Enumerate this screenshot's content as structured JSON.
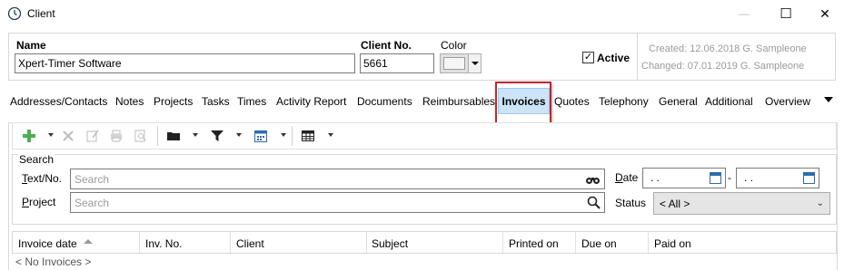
{
  "window": {
    "title": "Client",
    "minimize_glyph": "—",
    "maximize_glyph": "☐",
    "close_glyph": "✕"
  },
  "header": {
    "name_label": "Name",
    "name_value": "Xpert-Timer Software",
    "client_no_label": "Client No.",
    "client_no_value": "5661",
    "color_label": "Color",
    "active_label": "Active",
    "active_checked": true,
    "check_glyph": "✓",
    "created": "Created: 12.06.2018 G. Sampleone",
    "changed": "Changed: 07.01.2019 G. Sampleone"
  },
  "tabs": [
    {
      "label": "Addresses/Contacts"
    },
    {
      "label": "Notes"
    },
    {
      "label": "Projects"
    },
    {
      "label": "Tasks"
    },
    {
      "label": "Times"
    },
    {
      "label": "Activity Report"
    },
    {
      "label": "Documents"
    },
    {
      "label": "Reimbursables"
    },
    {
      "label": "Invoices",
      "active": true
    },
    {
      "label": "Quotes"
    },
    {
      "label": "Telephony"
    },
    {
      "label": "General"
    },
    {
      "label": "Additional"
    },
    {
      "label": "Overview"
    }
  ],
  "toolbar": {
    "icons": [
      "add-icon",
      "delete-icon",
      "edit-icon",
      "print-icon",
      "preview-icon",
      "folder-icon",
      "filter-icon",
      "calendar-icon",
      "table-icon"
    ]
  },
  "search": {
    "group_title": "Search",
    "text_label_u": "T",
    "text_label_rest": "ext/No.",
    "text_placeholder": "Search",
    "project_label_u": "P",
    "project_label_rest": "roject",
    "project_placeholder": "Search",
    "date_label_u": "D",
    "date_label_rest": "ate",
    "date_from": ". .",
    "date_separator": "-",
    "date_to": ". .",
    "status_label": "Status",
    "status_value": "< All >"
  },
  "grid": {
    "columns": [
      "Invoice date",
      "Inv. No.",
      "Client",
      "Subject",
      "Printed on",
      "Due on",
      "Paid on"
    ],
    "empty_text": "< No Invoices >"
  },
  "colors": {
    "active_tab_bg": "#cce4f7",
    "highlight_border": "#c0272d",
    "add_icon": "#4caf50",
    "calendar_icon": "#2b6cb0"
  }
}
